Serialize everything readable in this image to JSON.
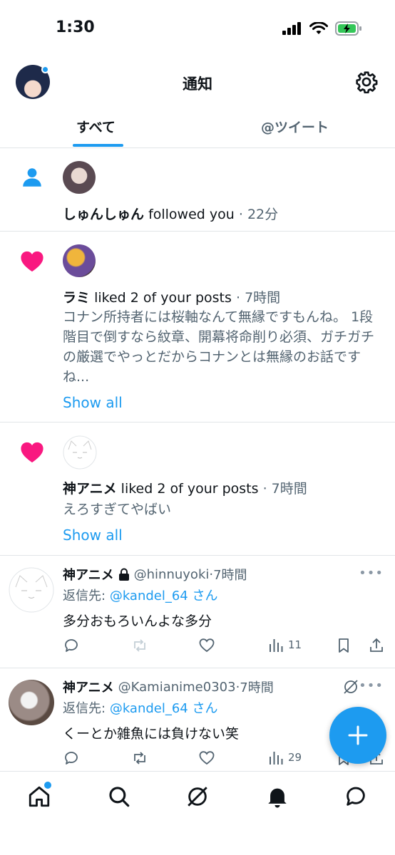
{
  "status_bar": {
    "time": "1:30"
  },
  "header": {
    "title": "通知"
  },
  "tabs": [
    {
      "label": "すべて",
      "active": true
    },
    {
      "label": "@ツイート",
      "active": false
    }
  ],
  "notifications": [
    {
      "type": "follow",
      "icon": "person-icon",
      "name": "しゅんしゅん",
      "action": "followed you",
      "time": "22分"
    },
    {
      "type": "like",
      "icon": "heart-icon",
      "name": "ラミ",
      "action": "liked 2 of your posts",
      "time": "7時間",
      "snippet": "コナン所持者には桜軸なんて無縁ですもんね。 1段階目で倒すなら紋章、開幕将命削り必須、ガチガチの厳選でやっとだからコナンとは無縁のお話ですね...",
      "show_all": "Show all"
    },
    {
      "type": "like",
      "icon": "heart-icon",
      "name": "神アニメ",
      "action": "liked 2 of your posts",
      "time": "7時間",
      "snippet": "えろすぎてやばい",
      "show_all": "Show all"
    }
  ],
  "tweets": [
    {
      "name": "神アニメ",
      "protected": true,
      "handle": "@hinnuyoki",
      "time": "7時間",
      "reply_prefix": "返信先:",
      "reply_to": "@kandel_64 さん",
      "text": "多分おもろいんよな多分",
      "views": "11"
    },
    {
      "name": "神アニメ",
      "protected": false,
      "handle": "@Kamianime0303",
      "time": "7時間",
      "reply_prefix": "返信先:",
      "reply_to": "@kandel_64 さん",
      "text": "くーとか雑魚には負けない笑",
      "views": "29"
    }
  ],
  "colors": {
    "accent": "#1d9bf0",
    "like": "#f91880",
    "text": "#0f1419",
    "muted": "#536471"
  }
}
